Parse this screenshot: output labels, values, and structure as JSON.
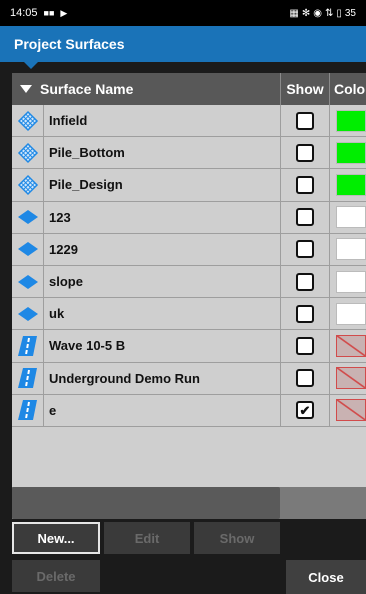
{
  "status_bar": {
    "time": "14:05",
    "battery": "35"
  },
  "app": {
    "title": "Project Surfaces"
  },
  "table": {
    "columns": {
      "name": "Surface Name",
      "show": "Show",
      "color": "Color"
    },
    "rows": [
      {
        "name": "Infield",
        "icon": "grid-surface-icon",
        "shown": false,
        "color": "#00ee00"
      },
      {
        "name": "Pile_Bottom",
        "icon": "grid-surface-icon",
        "shown": false,
        "color": "#00ee00"
      },
      {
        "name": "Pile_Design",
        "icon": "grid-surface-icon",
        "shown": false,
        "color": "#00ee00"
      },
      {
        "name": "123",
        "icon": "diamond-surface-icon",
        "shown": false,
        "color": "#ffffff"
      },
      {
        "name": "1229",
        "icon": "diamond-surface-icon",
        "shown": false,
        "color": "#ffffff"
      },
      {
        "name": "slope",
        "icon": "diamond-surface-icon",
        "shown": false,
        "color": "#ffffff"
      },
      {
        "name": "uk",
        "icon": "diamond-surface-icon",
        "shown": false,
        "color": "#ffffff"
      },
      {
        "name": "Wave 10-5 B",
        "icon": "road-surface-icon",
        "shown": false,
        "color": "none"
      },
      {
        "name": "Underground Demo Run",
        "icon": "road-surface-icon",
        "shown": false,
        "color": "none"
      },
      {
        "name": "e",
        "icon": "road-surface-icon",
        "shown": true,
        "color": "none"
      }
    ]
  },
  "buttons": {
    "new": "New...",
    "edit": "Edit",
    "show": "Show",
    "delete": "Delete",
    "close": "Close"
  },
  "colors": {
    "accent": "#1a73b8",
    "icon_blue": "#1e88e5"
  }
}
